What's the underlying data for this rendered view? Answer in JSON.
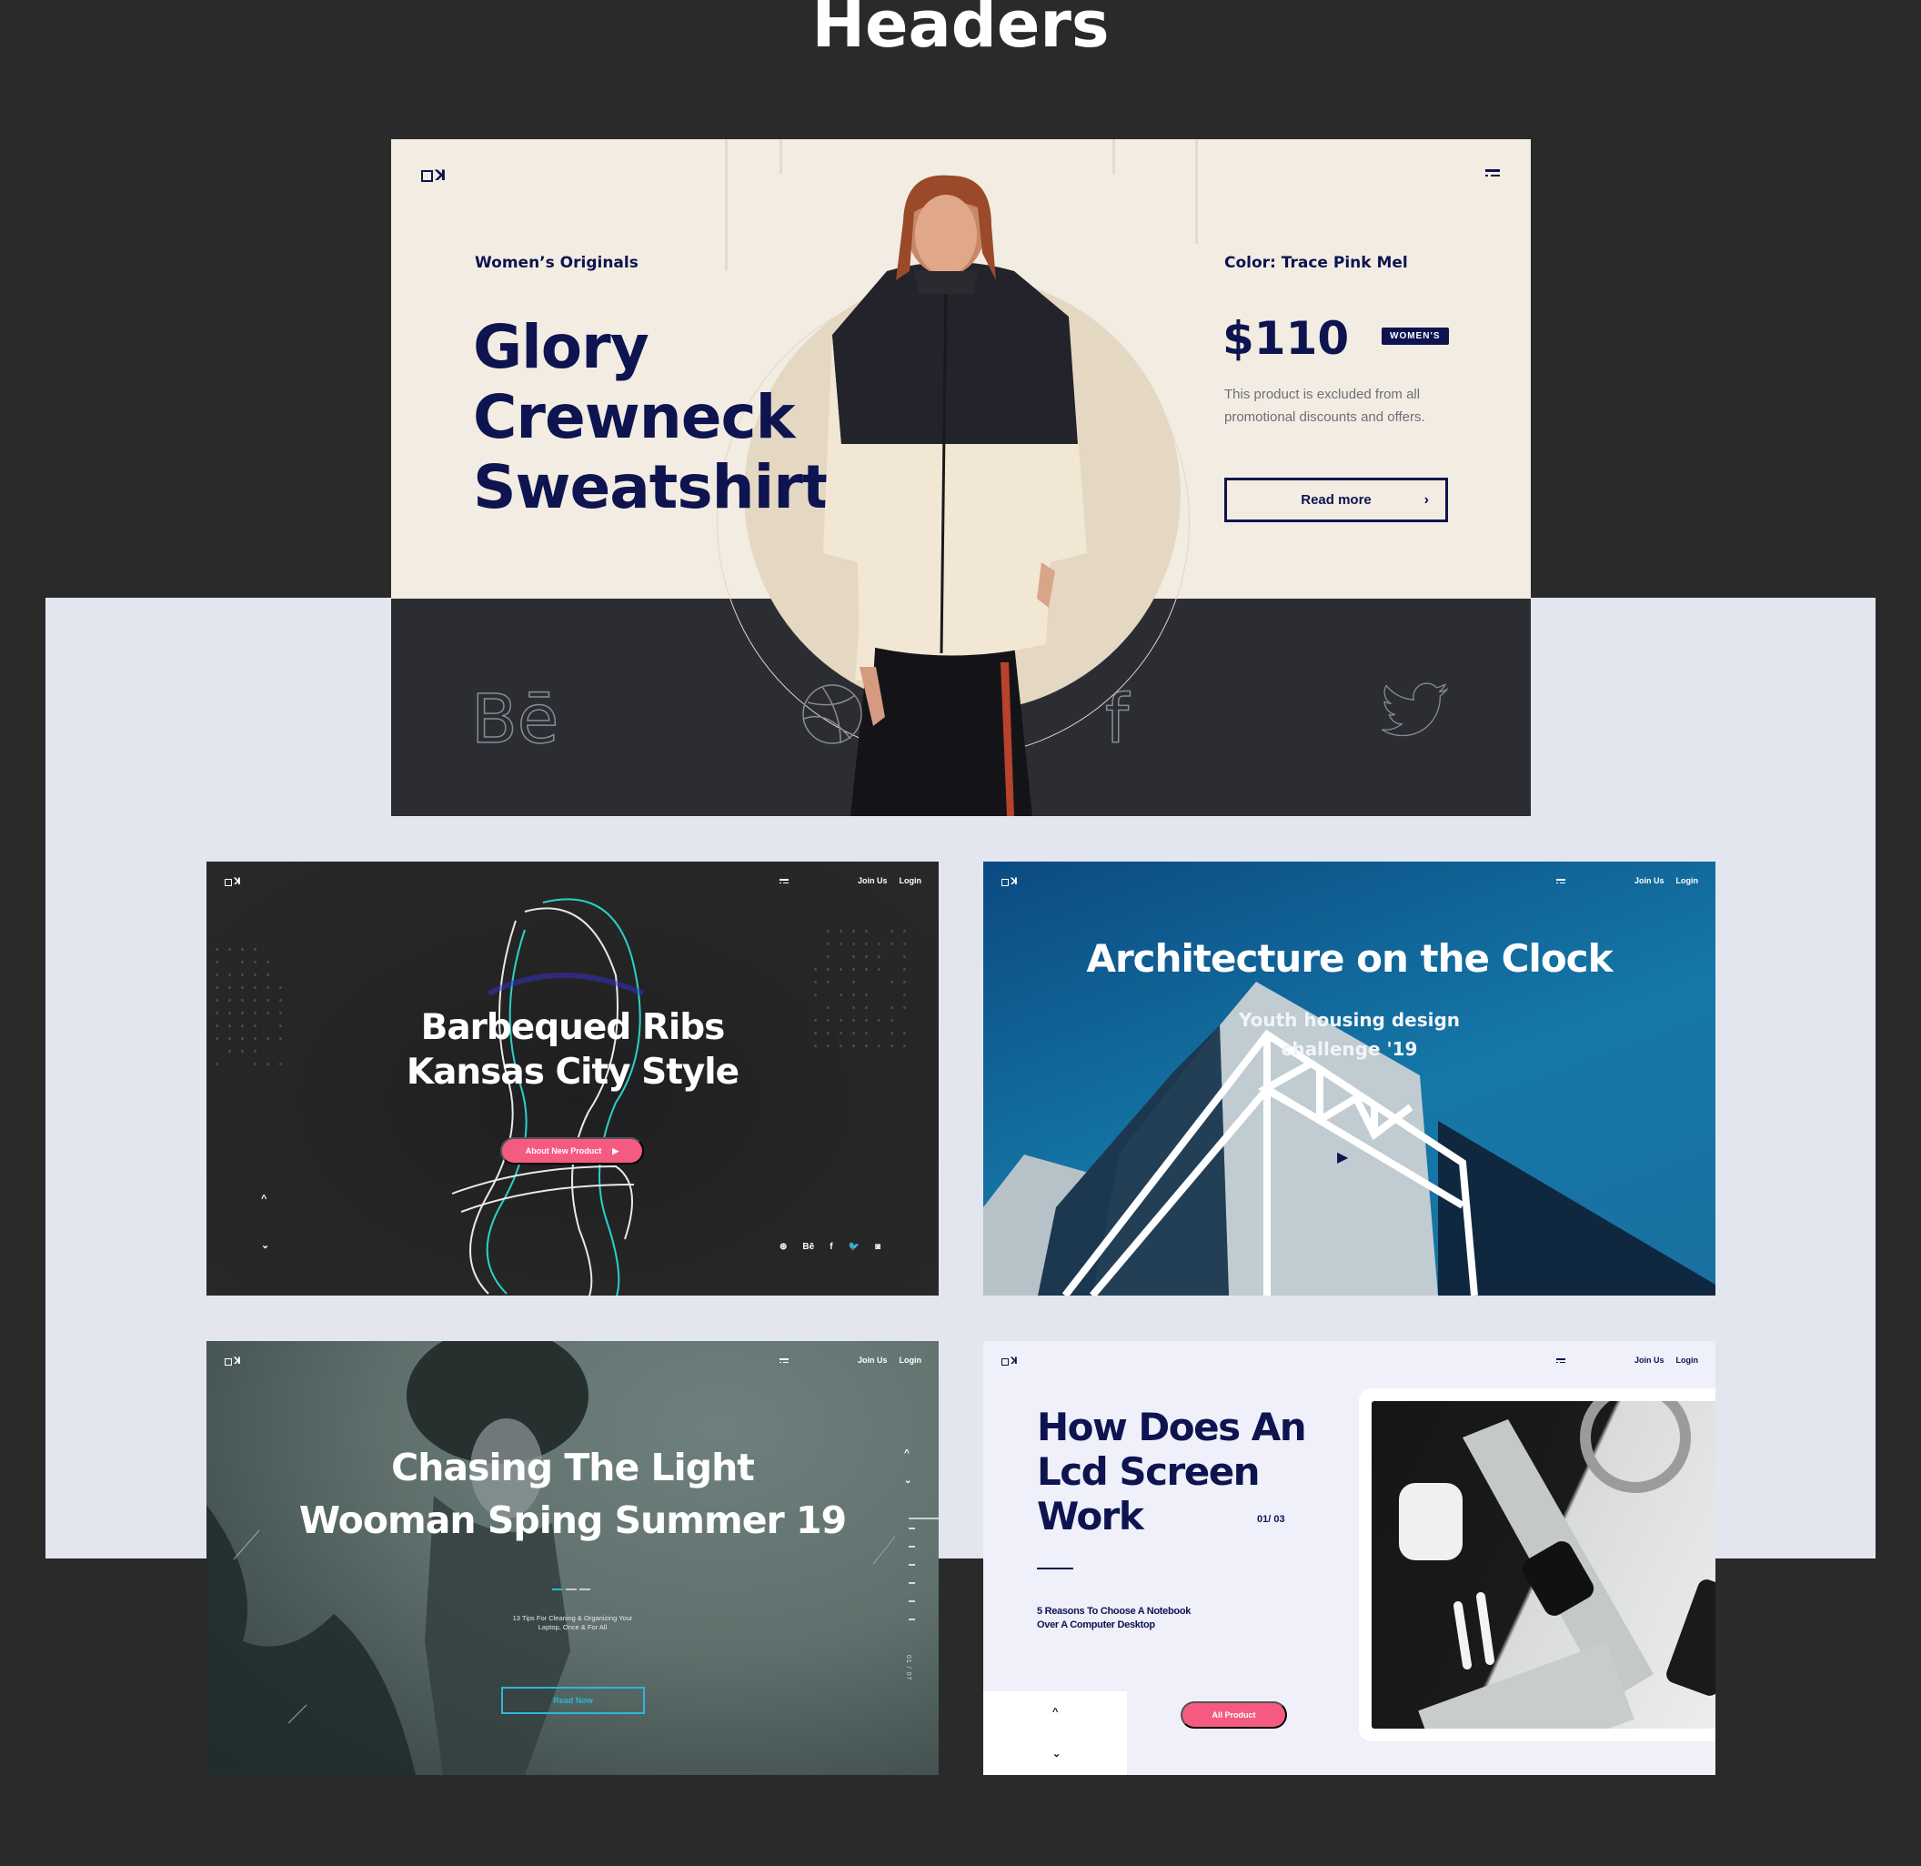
{
  "page": {
    "title": "Headers"
  },
  "colors": {
    "navy": "#0d1450",
    "pink": "#f55a81",
    "cyan": "#2bb8d6",
    "cream": "#f2ece2",
    "dark_bg": "#2a2a2a",
    "panel": "#e3e6ef"
  },
  "hero": {
    "logo": "ꓘ",
    "menu_icon": "menu-icon",
    "eyebrow": "Women’s Originals",
    "title_lines": [
      "Glory",
      "Crewneck",
      "Sweatshirt"
    ],
    "color_label": "Color: Trace Pink Mel",
    "price": "$110",
    "badge": "WOMEN'S",
    "description": "This product is excluded from all promotional discounts and offers.",
    "read_more": "Read more",
    "read_more_icon": "›",
    "socials": [
      {
        "name": "behance",
        "glyph": "Bē"
      },
      {
        "name": "dribbble",
        "glyph": "◎"
      },
      {
        "name": "facebook",
        "glyph": "f"
      },
      {
        "name": "twitter",
        "glyph": "🐦"
      }
    ]
  },
  "cards": [
    {
      "nav": {
        "join": "Join Us",
        "login": "Login"
      },
      "title_lines": [
        "Barbequed Ribs",
        "Kansas City Style"
      ],
      "button": "About New Product",
      "button_icon": "▶",
      "arrow_up": "^",
      "arrow_down": "⌄",
      "socials": [
        "⊛",
        "Bē",
        "f",
        "🐦",
        "◙"
      ]
    },
    {
      "nav": {
        "join": "Join Us",
        "login": "Login"
      },
      "title": "Architecture on the Clock",
      "subtitle_lines": [
        "Youth housing design",
        "challenge '19"
      ],
      "play_icon": "▶"
    },
    {
      "nav": {
        "join": "Join Us",
        "login": "Login"
      },
      "title_lines": [
        "Chasing The Light",
        "Wooman Sping Summer 19"
      ],
      "slide_progress": {
        "current": 1,
        "total": 3
      },
      "sub_lines": [
        "13 Tips For Cleaning & Organizing Your",
        "Laptop, Once & For All"
      ],
      "button": "Read Now",
      "arrow_up": "^",
      "arrow_down": "⌄",
      "counter": "01 / 07"
    },
    {
      "nav": {
        "join": "Join Us",
        "login": "Login"
      },
      "title_lines": [
        "How Does An",
        "Lcd Screen",
        "Work"
      ],
      "counter": "01/ 03",
      "sub_lines": [
        "5 Reasons To Choose A Notebook",
        "Over A Computer Desktop"
      ],
      "button": "All Product",
      "arrow_up": "^",
      "arrow_down": "⌄"
    }
  ]
}
